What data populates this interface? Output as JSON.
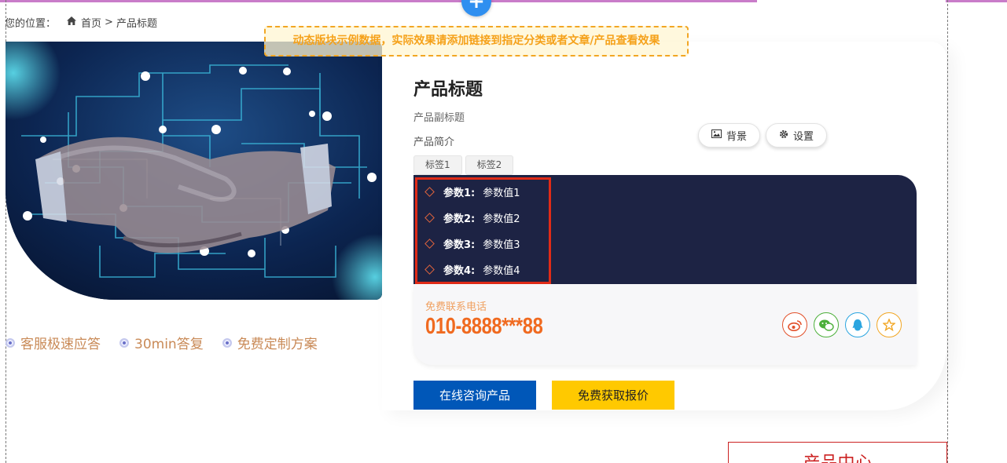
{
  "breadcrumb": {
    "prefix": "您的位置：",
    "home": "首页",
    "separator": ">",
    "current": "产品标题"
  },
  "notice": "动态版块示例数据，实际效果请添加链接到指定分类或者文章/产品查看效果",
  "product": {
    "title": "产品标题",
    "subtitle": "产品副标题",
    "intro": "产品简介",
    "tags": [
      "标签1",
      "标签2"
    ],
    "params": [
      {
        "key": "参数1:",
        "value": "参数值1"
      },
      {
        "key": "参数2:",
        "value": "参数值2"
      },
      {
        "key": "参数3:",
        "value": "参数值3"
      },
      {
        "key": "参数4:",
        "value": "参数值4"
      }
    ]
  },
  "editor": {
    "background_label": "背景",
    "settings_label": "设置",
    "add_symbol": "+"
  },
  "features": [
    "客服极速应答",
    "30min答复",
    "免费定制方案"
  ],
  "contact": {
    "label": "免费联系电话",
    "phone": "010-8888***88"
  },
  "social": [
    {
      "name": "weibo-icon",
      "color": "#e2502a"
    },
    {
      "name": "wechat-icon",
      "color": "#4caf3a"
    },
    {
      "name": "qq-icon",
      "color": "#2aa5e0"
    },
    {
      "name": "star-icon",
      "color": "#f2a623"
    }
  ],
  "buttons": {
    "consult": "在线咨询产品",
    "quote": "免费获取报价"
  },
  "section_heading": "产品中心",
  "colors": {
    "params_bg": "#1d2344",
    "consult_blue": "#0057b8",
    "quote_yellow": "#ffc900",
    "phone_orange": "#f06a20",
    "highlight_red": "#e02b17"
  }
}
